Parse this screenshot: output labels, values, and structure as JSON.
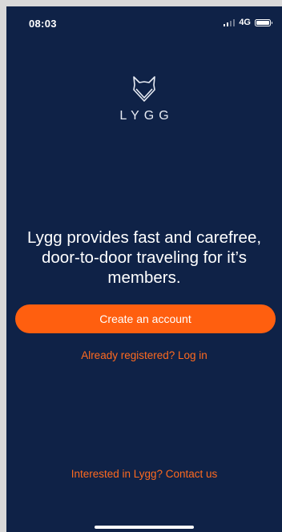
{
  "status_bar": {
    "time": "08:03",
    "network": "4G",
    "signal_icon": "signal-bars-icon",
    "battery_icon": "battery-icon"
  },
  "brand": {
    "logo_icon": "lygg-fox-logo-icon",
    "wordmark": "LYGG"
  },
  "main": {
    "headline": "Lygg provides fast and carefree, door-to-door traveling for it’s members.",
    "create_account_label": "Create an account",
    "login_label": "Already registered? Log in"
  },
  "footer": {
    "contact_label": "Interested in Lygg? Contact us"
  },
  "colors": {
    "background": "#0f2247",
    "accent": "#ff5f0f",
    "link": "#ff6a1f",
    "text": "#ffffff"
  }
}
